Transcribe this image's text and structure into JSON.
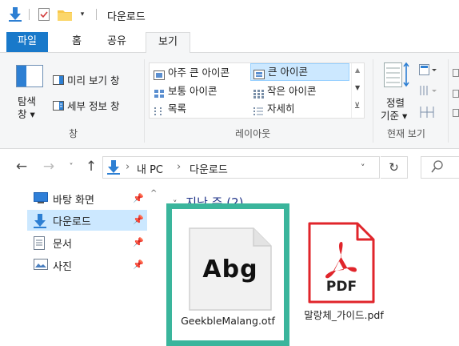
{
  "window": {
    "title": "다운로드"
  },
  "ribbon_tabs": [
    "파일",
    "홈",
    "공유",
    "보기"
  ],
  "ribbon": {
    "panes_group": {
      "nav_pane_label": "탐색\n창",
      "nav_pane_line1": "탐색",
      "nav_pane_line2": "창 ▾",
      "preview_pane": "미리 보기 창",
      "details_pane": "세부 정보 창",
      "label": "창"
    },
    "layout_group": {
      "items": [
        "아주 큰 아이콘",
        "큰 아이콘",
        "보통 아이콘",
        "작은 아이콘",
        "목록",
        "자세히"
      ],
      "selected": "큰 아이콘",
      "label": "레이아웃"
    },
    "current_view_group": {
      "sort_line1": "정렬",
      "sort_line2": "기준 ▾",
      "label": "현재 보기"
    }
  },
  "address": {
    "path": [
      "내 PC",
      "다운로드"
    ]
  },
  "nav_pane": {
    "items": [
      {
        "label": "바탕 화면",
        "pinned": true
      },
      {
        "label": "다운로드",
        "pinned": true
      },
      {
        "label": "문서",
        "pinned": true
      },
      {
        "label": "사진",
        "pinned": true
      }
    ]
  },
  "content": {
    "group_header": "지난 주 (2)",
    "files": [
      {
        "name": "GeekbleMalang.otf",
        "preview_text": "Abg",
        "selected": true
      },
      {
        "name": "말랑체_가이드.pdf",
        "badge": "PDF",
        "selected": false
      }
    ]
  },
  "colors": {
    "accent": "#1979ca",
    "selection_bg": "#cce8ff",
    "selection_border": "#99d1ff",
    "highlight_box": "#3ab59c",
    "pdf_red": "#e0252b",
    "folder_yellow": "#f8c74a"
  }
}
